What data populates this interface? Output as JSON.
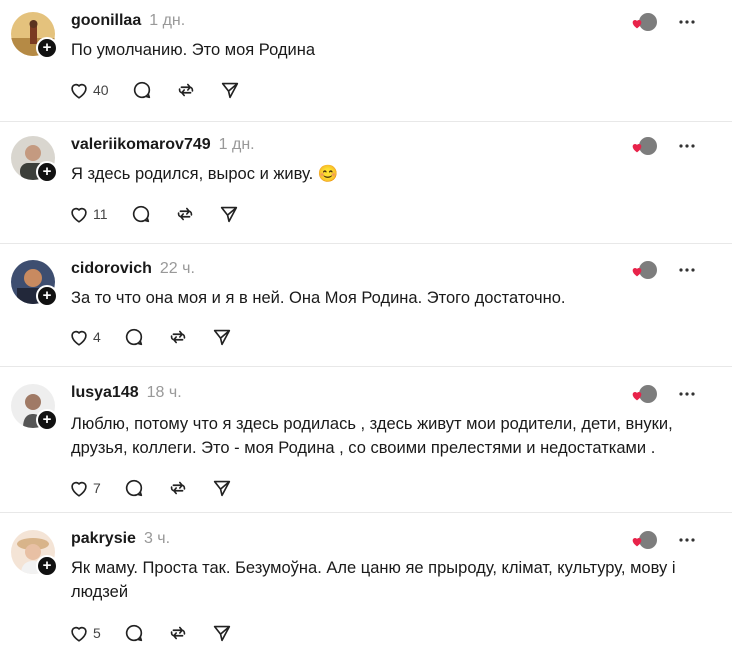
{
  "comments": [
    {
      "username": "goonillaa",
      "time": "1 дн.",
      "text": "По умолчанию. Это моя Родина",
      "likes": "40",
      "avatar_colors": [
        "#d9a35a",
        "#8a5a2b"
      ]
    },
    {
      "username": "valeriikomarov749",
      "time": "1 дн.",
      "text": "Я здесь родился, вырос и живу.",
      "emoji": "😊",
      "likes": "11",
      "avatar_colors": [
        "#6b6f66",
        "#d8d5cf"
      ]
    },
    {
      "username": "cidorovich",
      "time": "22 ч.",
      "text": "За то что она моя и я в ней. Она Моя Родина. Этого достаточно.",
      "likes": "4",
      "avatar_colors": [
        "#4a5a7a",
        "#c98a5a"
      ]
    },
    {
      "username": "lusya148",
      "time": "18 ч.",
      "text": "Люблю, потому что я здесь родилась , здесь живут мои родители, дети, внуки, друзья, коллеги. Это - моя Родина , со своими прелестями и недостатками .",
      "likes": "7",
      "avatar_colors": [
        "#e6e6e6",
        "#555555"
      ]
    },
    {
      "username": "pakrysie",
      "time": "3 ч.",
      "text": "Як маму. Проста так. Безумоўна. Але цаню яе прыроду, клімат, культуру, мову і людзей",
      "likes": "5",
      "avatar_colors": [
        "#f2dcc8",
        "#c89a6a"
      ]
    }
  ],
  "icons": {
    "like": "heart-icon",
    "reply": "comment-icon",
    "repost": "repost-icon",
    "share": "send-icon",
    "more": "more-icon",
    "liked_by_author": "heart-reaction-icon"
  },
  "colors": {
    "reaction_heart": "#e8234a",
    "follow_badge": "#111111"
  }
}
